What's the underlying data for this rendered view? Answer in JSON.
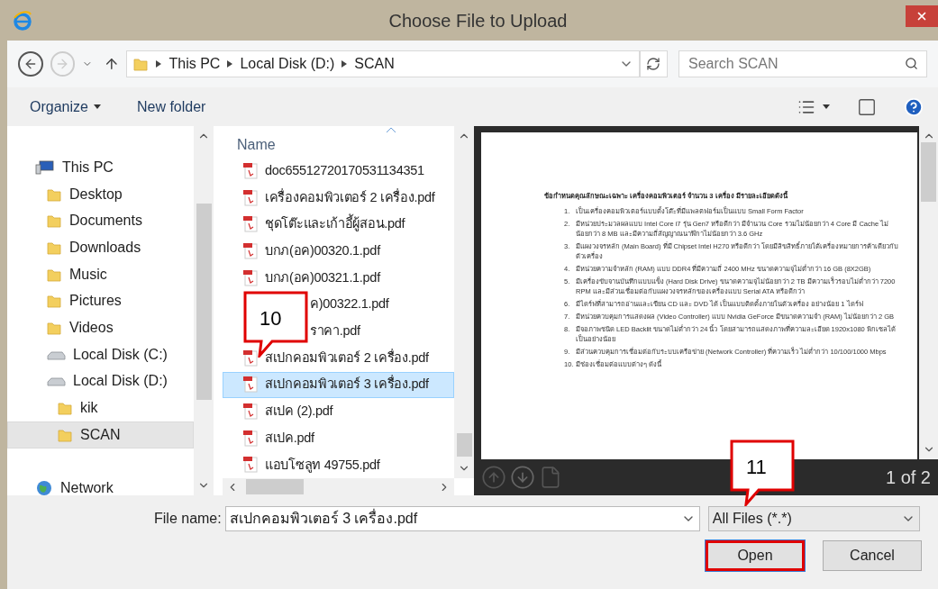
{
  "window": {
    "title": "Choose File to Upload"
  },
  "navigation": {
    "back_disabled": false,
    "forward_disabled": true
  },
  "breadcrumb": [
    "This PC",
    "Local Disk (D:)",
    "SCAN"
  ],
  "search": {
    "placeholder": "Search SCAN"
  },
  "toolbar": [
    {
      "label": "Organize",
      "kind": "menu"
    },
    {
      "label": "New folder",
      "kind": "button"
    }
  ],
  "sidebar": {
    "items": [
      {
        "label": "This PC",
        "kind": "pc",
        "selected": false,
        "children": [
          {
            "label": "Desktop",
            "kind": "folder",
            "selected": false
          },
          {
            "label": "Documents",
            "kind": "folder",
            "selected": false
          },
          {
            "label": "Downloads",
            "kind": "folder",
            "selected": false
          },
          {
            "label": "Music",
            "kind": "folder",
            "selected": false
          },
          {
            "label": "Pictures",
            "kind": "folder",
            "selected": false
          },
          {
            "label": "Videos",
            "kind": "folder",
            "selected": false
          },
          {
            "label": "Local Disk (C:)",
            "kind": "drive",
            "selected": false
          },
          {
            "label": "Local Disk (D:)",
            "kind": "drive",
            "selected": false,
            "children": [
              {
                "label": "kik",
                "kind": "folder",
                "selected": false
              },
              {
                "label": "SCAN",
                "kind": "folder",
                "selected": true
              }
            ]
          }
        ]
      },
      {
        "label": "Network",
        "kind": "network",
        "selected": false
      }
    ]
  },
  "file_list": {
    "column": "Name",
    "files": [
      {
        "name": "doc65512720170531134351",
        "selected": false,
        "covered": false
      },
      {
        "name": "เครื่องคอมพิวเตอร์ 2 เครื่อง.pdf",
        "selected": false,
        "covered": false
      },
      {
        "name": "ชุดโต๊ะและเก้าอี้ผู้สอน.pdf",
        "selected": false,
        "covered": false
      },
      {
        "name": "บกภ(อค)00320.1.pdf",
        "selected": false,
        "covered": false
      },
      {
        "name": "บกภ(อค)00321.1.pdf",
        "selected": false,
        "covered": false
      },
      {
        "name": "ค)00322.1.pdf",
        "selected": false,
        "covered": true
      },
      {
        "name": "ราคา.pdf",
        "selected": false,
        "covered": true
      },
      {
        "name": "สเปกคอมพิวเตอร์ 2 เครื่อง.pdf",
        "selected": false,
        "covered": false
      },
      {
        "name": "สเปกคอมพิวเตอร์ 3 เครื่อง.pdf",
        "selected": true,
        "covered": false
      },
      {
        "name": "สเปค (2).pdf",
        "selected": false,
        "covered": false
      },
      {
        "name": "สเปค.pdf",
        "selected": false,
        "covered": false
      },
      {
        "name": "แอบโซลูท 49755.pdf",
        "selected": false,
        "covered": false
      }
    ]
  },
  "preview": {
    "heading": "ข้อกำหนดคุณลักษณะเฉพาะ เครื่องคอมพิวเตอร์ จำนวน 3 เครื่อง มีรายละเอียดดังนี้",
    "items": [
      {
        "number": "1.",
        "text": "เป็นเครื่องคอมพิวเตอร์แบบตั้งโต๊ะที่มีแพลตฟอร์มเป็นแบบ Small Form Factor"
      },
      {
        "number": "2.",
        "text": "มีหน่วยประมวลผลแบบ Intel Core i7 รุ่น Gen7 หรือดีกว่า มีจำนวน Core รวมไม่น้อยกว่า 4 Core มี Cache ไม่น้อยกว่า 8 MB และมีความถี่สัญญาณนาฬิกาไม่น้อยกว่า 3.6 GHz"
      },
      {
        "number": "3.",
        "text": "มีแผงวงจรหลัก (Main Board) ที่มี Chipset Intel H270 หรือดีกว่า โดยมีลิขสิทธิ์ภายใต้เครื่องหมายการค้าเดียวกับตัวเครื่อง"
      },
      {
        "number": "4.",
        "text": "มีหน่วยความจำหลัก (RAM) แบบ DDR4 ที่มีความถี่ 2400 MHz ขนาดความจุไม่ต่ำกว่า 16 GB (8X2GB)"
      },
      {
        "number": "5.",
        "text": "มีเครื่องขับจานบันทึกแบบแข็ง (Hard Disk Drive) ขนาดความจุไม่น้อยกว่า 2 TB มีความเร็วรอบไม่ต่ำกว่า 7200 RPM และมีส่วนเชื่อมต่อกับแผงวงจรหลักของเครื่องแบบ Serial ATA หรือดีกว่า"
      },
      {
        "number": "6.",
        "text": "มีไดร์ฟที่สามารถอ่านและเขียน CD และ DVD ได้ เป็นแบบติดตั้งภายในตัวเครื่อง อย่างน้อย 1 ไดร์ฟ"
      },
      {
        "number": "7.",
        "text": "มีหน่วยควบคุมการแสดงผล (Video Controller) แบบ Nvidia GeForce มีขนาดความจำ (RAM) ไม่น้อยกว่า 2 GB"
      },
      {
        "number": "8.",
        "text": "มีจอภาพชนิด LED Backlit ขนาดไม่ต่ำกว่า 24 นิ้ว โดยสามารถแสดงภาพที่ความละเอียด 1920x1080 พิกเซลได้เป็นอย่างน้อย"
      },
      {
        "number": "9.",
        "text": "มีส่วนควบคุมการเชื่อมต่อกับระบบเครือข่าย (Network Controller) ที่ความเร็ว ไม่ต่ำกว่า 10/100/1000 Mbps"
      },
      {
        "number": "10.",
        "text": "มีช่องเชื่อมต่อแบบต่างๆ ดังนี้"
      }
    ],
    "page_indicator": "1 of 2"
  },
  "file_name": {
    "label": "File name:",
    "value": "สเปกคอมพิวเตอร์ 3 เครื่อง.pdf"
  },
  "filter": {
    "value": "All Files (*.*)"
  },
  "buttons": [
    {
      "label": "Open",
      "highlighted": true
    },
    {
      "label": "Cancel",
      "highlighted": false
    }
  ],
  "callouts": [
    {
      "text": "10"
    },
    {
      "text": "11"
    }
  ]
}
